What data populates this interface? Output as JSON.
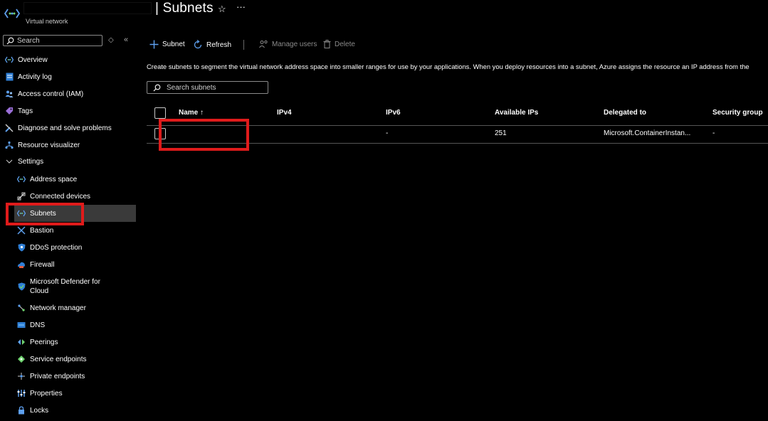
{
  "header": {
    "title": "| Subnets",
    "subtitle": "Virtual network",
    "star_icon": "star-icon",
    "more_icon": "more-icon"
  },
  "sidebar": {
    "search_placeholder": "Search",
    "items": [
      {
        "label": "Overview",
        "icon": "overview-icon"
      },
      {
        "label": "Activity log",
        "icon": "activity-log-icon"
      },
      {
        "label": "Access control (IAM)",
        "icon": "people-icon"
      },
      {
        "label": "Tags",
        "icon": "tag-icon"
      },
      {
        "label": "Diagnose and solve problems",
        "icon": "wrench-icon"
      },
      {
        "label": "Resource visualizer",
        "icon": "visualizer-icon"
      },
      {
        "label": "Settings",
        "icon": "chevron-down-icon"
      },
      {
        "label": "Address space",
        "icon": "address-space-icon"
      },
      {
        "label": "Connected devices",
        "icon": "plug-icon"
      },
      {
        "label": "Subnets",
        "icon": "subnet-icon"
      },
      {
        "label": "Bastion",
        "icon": "bastion-icon"
      },
      {
        "label": "DDoS protection",
        "icon": "shield-icon"
      },
      {
        "label": "Firewall",
        "icon": "firewall-icon"
      },
      {
        "label": "Microsoft Defender for Cloud",
        "icon": "defender-icon"
      },
      {
        "label": "Network manager",
        "icon": "network-manager-icon"
      },
      {
        "label": "DNS",
        "icon": "dns-icon"
      },
      {
        "label": "Peerings",
        "icon": "peerings-icon"
      },
      {
        "label": "Service endpoints",
        "icon": "service-endpoint-icon"
      },
      {
        "label": "Private endpoints",
        "icon": "private-endpoint-icon"
      },
      {
        "label": "Properties",
        "icon": "properties-icon"
      },
      {
        "label": "Locks",
        "icon": "lock-icon"
      }
    ],
    "selected": "Subnets"
  },
  "toolbar": {
    "add_subnet": "Subnet",
    "refresh": "Refresh",
    "manage_users": "Manage users",
    "delete": "Delete"
  },
  "description": "Create subnets to segment the virtual network address space into smaller ranges for use by your applications. When you deploy resources into a subnet, Azure assigns the resource an IP address from the",
  "search_subnets_placeholder": "Search subnets",
  "table": {
    "columns": [
      "Name ↑",
      "IPv4",
      "IPv6",
      "Available IPs",
      "Delegated to",
      "Security group"
    ],
    "rows": [
      {
        "name": "",
        "ipv4": "",
        "ipv6": "-",
        "available_ips": "251",
        "delegated_to": "Microsoft.ContainerInstan...",
        "security_group": "-"
      }
    ]
  },
  "colors": {
    "background": "#000000",
    "accent": "#0078d4",
    "highlight": "#e01b1b",
    "selected_bg": "#3a3a3a"
  }
}
